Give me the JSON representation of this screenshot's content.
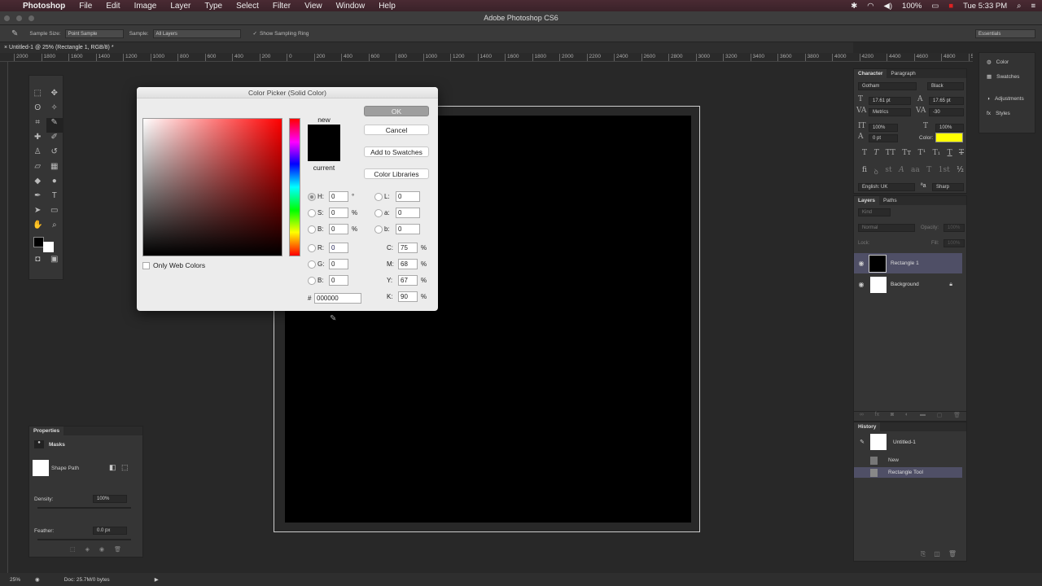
{
  "menubar": {
    "app": "Photoshop",
    "items": [
      "File",
      "Edit",
      "Image",
      "Layer",
      "Type",
      "Select",
      "Filter",
      "View",
      "Window",
      "Help"
    ],
    "battery": "100%",
    "clock": "Tue 5:33 PM"
  },
  "window": {
    "title": "Adobe Photoshop CS6"
  },
  "options": {
    "sample_size_label": "Sample Size:",
    "sample_size": "Point Sample",
    "sample_label": "Sample:",
    "sample": "All Layers",
    "show_ring": "Show Sampling Ring",
    "workspace": "Essentials"
  },
  "document": {
    "tab": "Untitled-1 @ 25% (Rectangle 1, RGB/8) *"
  },
  "ruler": {
    "labels": [
      "2000",
      "1800",
      "1600",
      "1400",
      "1200",
      "1000",
      "800",
      "600",
      "400",
      "200",
      "0",
      "200",
      "400",
      "600",
      "800",
      "1000",
      "1200",
      "1400",
      "1600",
      "1800",
      "2000",
      "2200",
      "2400",
      "2600",
      "2800",
      "3000",
      "3200",
      "3400",
      "3600",
      "3800",
      "4000",
      "4200",
      "4400",
      "4600",
      "4800",
      "50"
    ]
  },
  "color_picker": {
    "title": "Color Picker (Solid Color)",
    "new_label": "new",
    "current_label": "current",
    "new_color": "#000000",
    "current_color": "#000000",
    "buttons": {
      "ok": "OK",
      "cancel": "Cancel",
      "add_swatches": "Add to Swatches",
      "libraries": "Color Libraries"
    },
    "only_web": "Only Web Colors",
    "hsb": [
      {
        "label": "H:",
        "value": "0",
        "unit": "°"
      },
      {
        "label": "S:",
        "value": "0",
        "unit": "%"
      },
      {
        "label": "B:",
        "value": "0",
        "unit": "%"
      }
    ],
    "rgb": [
      {
        "label": "R:",
        "value": "0"
      },
      {
        "label": "G:",
        "value": "0"
      },
      {
        "label": "B:",
        "value": "0"
      }
    ],
    "lab": [
      {
        "label": "L:",
        "value": "0"
      },
      {
        "label": "a:",
        "value": "0"
      },
      {
        "label": "b:",
        "value": "0"
      }
    ],
    "cmyk": [
      {
        "label": "C:",
        "value": "75",
        "unit": "%"
      },
      {
        "label": "M:",
        "value": "68",
        "unit": "%"
      },
      {
        "label": "Y:",
        "value": "67",
        "unit": "%"
      },
      {
        "label": "K:",
        "value": "90",
        "unit": "%"
      }
    ],
    "hex_label": "#",
    "hex": "000000"
  },
  "character": {
    "tabs": [
      "Character",
      "Paragraph"
    ],
    "font": "Gotham",
    "style": "Black",
    "size": "17.61 pt",
    "leading": "17.65 pt",
    "kerning": "Metrics",
    "tracking": "-30",
    "vscale": "100%",
    "hscale": "100%",
    "baseline": "0 pt",
    "color_label": "Color:",
    "color": "#ffff00",
    "language": "English: UK",
    "aa": "Sharp"
  },
  "layers": {
    "tabs": [
      "Layers",
      "Paths"
    ],
    "kind": "Kind",
    "blend": "Normal",
    "opacity_label": "Opacity:",
    "opacity": "100%",
    "lock_label": "Lock:",
    "fill_label": "Fill:",
    "fill": "100%",
    "items": [
      {
        "name": "Rectangle 1",
        "selected": true
      },
      {
        "name": "Background",
        "selected": false
      }
    ]
  },
  "dock": {
    "items": [
      "Color",
      "Swatches",
      "Adjustments",
      "Styles"
    ]
  },
  "history": {
    "title": "History",
    "snapshot": "Untitled-1",
    "items": [
      "New",
      "Rectangle Tool"
    ]
  },
  "properties": {
    "title": "Properties",
    "section": "Masks",
    "shape": "Shape Path",
    "density_label": "Density:",
    "density": "100%",
    "feather_label": "Feather:",
    "feather": "0.0 px"
  },
  "statusbar": {
    "zoom": "25%",
    "doc": "Doc: 25.7M/0 bytes"
  }
}
